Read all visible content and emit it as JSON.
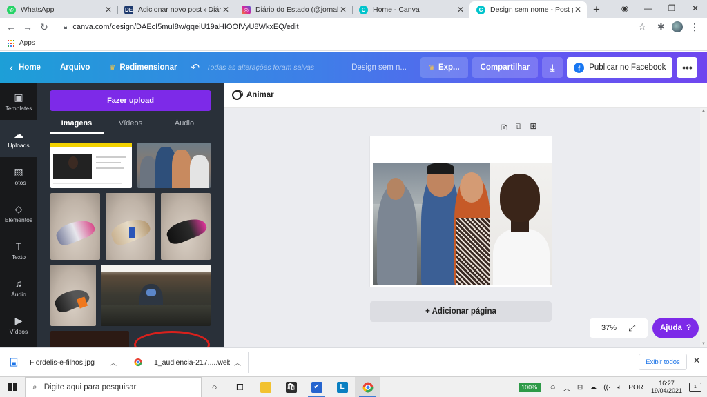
{
  "browser": {
    "tabs": [
      {
        "title": "WhatsApp",
        "favicon_color": "#25d366",
        "favicon_glyph": "✆",
        "active": false
      },
      {
        "title": "Adicionar novo post ‹ Diário do E",
        "favicon_color": "#1e3a6e",
        "favicon_glyph": "DE",
        "active": false
      },
      {
        "title": "Diário do Estado (@jornal_diario",
        "favicon_color": "#d6249f",
        "favicon_glyph": "◎",
        "active": false
      },
      {
        "title": "Home - Canva",
        "favicon_color": "#00c4cc",
        "favicon_glyph": "C",
        "active": false
      },
      {
        "title": "Design sem nome - Post para Fac",
        "favicon_color": "#00c4cc",
        "favicon_glyph": "C",
        "active": true
      }
    ],
    "url": "canva.com/design/DAEcI5muI8w/gqeiU19aHIOOIVyU8WkxEQ/edit",
    "bookmark_apps": "Apps"
  },
  "canva": {
    "home": "Home",
    "file": "Arquivo",
    "resize": "Redimensionar",
    "saved_status": "Todas as alterações foram salvas",
    "design_name": "Design sem n...",
    "export": "Exp...",
    "share": "Compartilhar",
    "publish": "Publicar no Facebook",
    "rail": [
      {
        "label": "Templates",
        "icon": "templates-icon",
        "glyph": "▣"
      },
      {
        "label": "Uploads",
        "icon": "upload-cloud-icon",
        "glyph": "☁"
      },
      {
        "label": "Fotos",
        "icon": "photos-icon",
        "glyph": "▨"
      },
      {
        "label": "Elementos",
        "icon": "elements-icon",
        "glyph": "◇"
      },
      {
        "label": "Texto",
        "icon": "text-icon",
        "glyph": "T"
      },
      {
        "label": "Áudio",
        "icon": "audio-icon",
        "glyph": "♫"
      },
      {
        "label": "Vídeos",
        "icon": "video-icon",
        "glyph": "▶"
      }
    ],
    "upload_button": "Fazer upload",
    "panel_tabs": [
      "Imagens",
      "Vídeos",
      "Áudio"
    ],
    "animate": "Animar",
    "add_page": "+ Adicionar página",
    "zoom": "37%",
    "help": "Ajuda",
    "help_icon": "?"
  },
  "downloads": {
    "items": [
      {
        "name": "Flordelis-e-filhos.jpg",
        "icon": "image-file-icon"
      },
      {
        "name": "1_audiencia-217.....webp",
        "icon": "chrome-file-icon"
      }
    ],
    "show_all": "Exibir todos"
  },
  "taskbar": {
    "search_placeholder": "Digite aqui para pesquisar",
    "battery": "100%",
    "language": "POR",
    "time": "16:27",
    "date": "19/04/2021",
    "notification_count": "1"
  },
  "colors": {
    "canva_purple": "#7d2ae8",
    "panel_bg": "#293039",
    "rail_bg": "#18191b",
    "facebook_blue": "#1877f2"
  }
}
